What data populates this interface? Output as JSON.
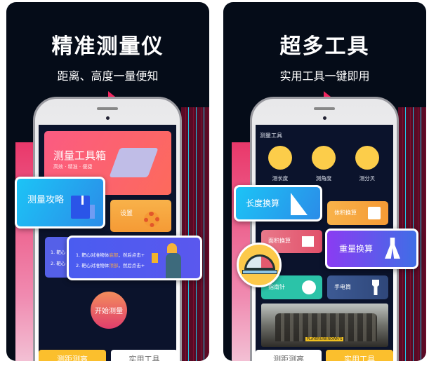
{
  "panel1": {
    "title": "精准测量仪",
    "subtitle": "距离、高度一量便知",
    "banner": {
      "title": "测量工具箱",
      "tagline": "高效 · 精准 · 便捷"
    },
    "guide_card": {
      "label": "测量攻略",
      "icon": "book-icon"
    },
    "settings_card": {
      "label": "设置",
      "icon": "gear-icon"
    },
    "instructions": {
      "line1_prefix": "1. 靶心对准物体",
      "line1_highlight": "底部",
      "line1_suffix": "，然后点击+",
      "line2_prefix": "2. 靶心对准物体",
      "line2_highlight": "顶部",
      "line2_suffix": "，然后点击+",
      "back_line1": "1. 靶心",
      "back_line2": "2. 靶心"
    },
    "start_button": "开始测量",
    "tabs": [
      {
        "label": "测距测高",
        "active": true
      },
      {
        "label": "实用工具",
        "active": false
      }
    ]
  },
  "panel2": {
    "title": "超多工具",
    "subtitle": "实用工具一键即用",
    "section_title": "测量工具",
    "tools": [
      {
        "label": "测长度",
        "icon": "tape-measure-icon"
      },
      {
        "label": "测角度",
        "icon": "protractor-icon"
      },
      {
        "label": "测分贝",
        "icon": "drill-icon"
      }
    ],
    "cards": {
      "length": "长度换算",
      "volume": "体积换算",
      "area": "面积换算",
      "weight": "重量换算",
      "compass": "指南针",
      "flashlight": "手电筒"
    },
    "ad_banner_text": "PLAYERUNKNOWN'S",
    "tabs": [
      {
        "label": "测距测高",
        "active": false
      },
      {
        "label": "实用工具",
        "active": true
      }
    ]
  },
  "colors": {
    "background": "#050c18",
    "accent_pink": "#f0245e",
    "tab_yellow": "#fbbf2d",
    "screen": "#0b132c"
  }
}
